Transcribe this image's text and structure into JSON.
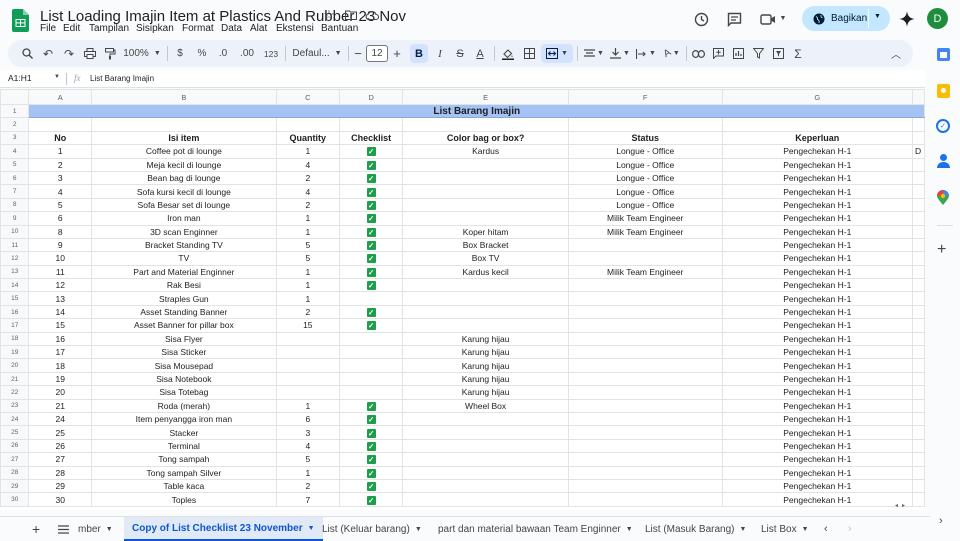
{
  "app": {
    "logo_icon": "sheets-logo-icon"
  },
  "title": {
    "doc_title": "List Loading Imajin Item at Plastics And Rubber 23 Nov"
  },
  "menu": [
    "File",
    "Edit",
    "Tampilan",
    "Sisipkan",
    "Format",
    "Data",
    "Alat",
    "Ekstensi",
    "Bantuan"
  ],
  "header_right": {
    "share_label": "Bagikan",
    "avatar_letter": "D"
  },
  "toolbar": {
    "zoom": "100%",
    "currency": "$",
    "percent": "%",
    "dec_less": ".0",
    "dec_more": ".00",
    "number_fmt": "123",
    "font": "Defaul...",
    "font_size": "12"
  },
  "formula_bar": {
    "cell_ref": "A1:H1",
    "fx": "fx",
    "content": "List Barang Imajin"
  },
  "grid": {
    "columns": [
      "A",
      "B",
      "C",
      "D",
      "E",
      "F",
      "G"
    ],
    "title": "List Barang Imajin",
    "headers": [
      "No",
      "Isi item",
      "Quantity",
      "Checklist",
      "Color bag or box?",
      "Status",
      "Keperluan"
    ],
    "overflow_text": "D",
    "rows": [
      {
        "no": "1",
        "item": "Coffee pot di lounge",
        "qty": "1",
        "check": true,
        "bag": "Kardus",
        "status": "Longue - Office",
        "need": "Pengechekan H-1"
      },
      {
        "no": "2",
        "item": "Meja kecil di lounge",
        "qty": "4",
        "check": true,
        "bag": "",
        "status": "Longue - Office",
        "need": "Pengechekan H-1"
      },
      {
        "no": "3",
        "item": "Bean bag di lounge",
        "qty": "2",
        "check": true,
        "bag": "",
        "status": "Longue - Office",
        "need": "Pengechekan H-1"
      },
      {
        "no": "4",
        "item": "Sofa kursi kecil di lounge",
        "qty": "4",
        "check": true,
        "bag": "",
        "status": "Longue - Office",
        "need": "Pengechekan H-1"
      },
      {
        "no": "5",
        "item": "Sofa Besar set di lounge",
        "qty": "2",
        "check": true,
        "bag": "",
        "status": "Longue - Office",
        "need": "Pengechekan H-1"
      },
      {
        "no": "6",
        "item": "Iron man",
        "qty": "1",
        "check": true,
        "bag": "",
        "status": "Milik Team Engineer",
        "need": "Pengechekan H-1"
      },
      {
        "no": "8",
        "item": "3D scan Enginner",
        "qty": "1",
        "check": true,
        "bag": "Koper hitam",
        "status": "Milik Team Engineer",
        "need": "Pengechekan H-1"
      },
      {
        "no": "9",
        "item": "Bracket Standing TV",
        "qty": "5",
        "check": true,
        "bag": "Box Bracket",
        "status": "",
        "need": "Pengechekan H-1"
      },
      {
        "no": "10",
        "item": "TV",
        "qty": "5",
        "check": true,
        "bag": "Box TV",
        "status": "",
        "need": "Pengechekan H-1"
      },
      {
        "no": "11",
        "item": "Part and Material Enginner",
        "qty": "1",
        "check": true,
        "bag": "Kardus kecil",
        "status": "Milik Team Engineer",
        "need": "Pengechekan H-1"
      },
      {
        "no": "12",
        "item": "Rak Besi",
        "qty": "1",
        "check": true,
        "bag": "",
        "status": "",
        "need": "Pengechekan H-1"
      },
      {
        "no": "13",
        "item": "Straples Gun",
        "qty": "1",
        "check": false,
        "bag": "",
        "status": "",
        "need": "Pengechekan H-1"
      },
      {
        "no": "14",
        "item": "Asset Standing Banner",
        "qty": "2",
        "check": true,
        "bag": "",
        "status": "",
        "need": "Pengechekan H-1"
      },
      {
        "no": "15",
        "item": "Asset Banner for pillar box",
        "qty": "15",
        "check": true,
        "bag": "",
        "status": "",
        "need": "Pengechekan H-1"
      },
      {
        "no": "16",
        "item": "Sisa Flyer",
        "qty": "",
        "check": false,
        "bag": "Karung hijau",
        "status": "",
        "need": "Pengechekan H-1"
      },
      {
        "no": "17",
        "item": "Sisa Sticker",
        "qty": "",
        "check": false,
        "bag": "Karung hijau",
        "status": "",
        "need": "Pengechekan H-1"
      },
      {
        "no": "18",
        "item": "Sisa Mousepad",
        "qty": "",
        "check": false,
        "bag": "Karung hijau",
        "status": "",
        "need": "Pengechekan H-1"
      },
      {
        "no": "19",
        "item": "Sisa Notebook",
        "qty": "",
        "check": false,
        "bag": "Karung hijau",
        "status": "",
        "need": "Pengechekan H-1"
      },
      {
        "no": "20",
        "item": "Sisa Totebag",
        "qty": "",
        "check": false,
        "bag": "Karung hijau",
        "status": "",
        "need": "Pengechekan H-1"
      },
      {
        "no": "21",
        "item": "Roda (merah)",
        "qty": "1",
        "check": true,
        "bag": "Wheel Box",
        "status": "",
        "need": "Pengechekan H-1"
      },
      {
        "no": "24",
        "item": "Item penyangga iron man",
        "qty": "6",
        "check": true,
        "bag": "",
        "status": "",
        "need": "Pengechekan H-1"
      },
      {
        "no": "25",
        "item": "Stacker",
        "qty": "3",
        "check": true,
        "bag": "",
        "status": "",
        "need": "Pengechekan H-1"
      },
      {
        "no": "26",
        "item": "Terminal",
        "qty": "4",
        "check": true,
        "bag": "",
        "status": "",
        "need": "Pengechekan H-1"
      },
      {
        "no": "27",
        "item": "Tong sampah",
        "qty": "5",
        "check": true,
        "bag": "",
        "status": "",
        "need": "Pengechekan H-1"
      },
      {
        "no": "28",
        "item": "Tong sampah Silver",
        "qty": "1",
        "check": true,
        "bag": "",
        "status": "",
        "need": "Pengechekan H-1"
      },
      {
        "no": "29",
        "item": "Table kaca",
        "qty": "2",
        "check": true,
        "bag": "",
        "status": "",
        "need": "Pengechekan H-1"
      },
      {
        "no": "30",
        "item": "Toples",
        "qty": "7",
        "check": true,
        "bag": "",
        "status": "",
        "need": "Pengechekan H-1"
      }
    ]
  },
  "tabs": {
    "items": [
      "mber",
      "Copy of List Checklist 23 November",
      "List (Keluar barang)",
      "part dan material bawaan Team Enginner",
      "List (Masuk Barang)",
      "List Box"
    ],
    "active_index": 1
  },
  "colors": {
    "title_fill": "#a4c2f4",
    "active_tab": "#0b57d0",
    "check": "#1e9e4a",
    "share_bg": "#c2e7ff"
  }
}
